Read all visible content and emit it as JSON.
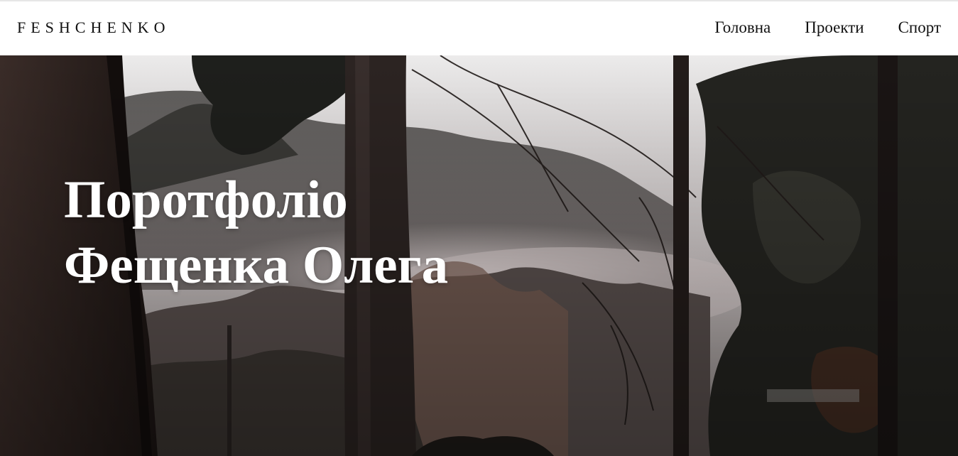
{
  "header": {
    "brand": "FESHCHENKO",
    "nav": [
      {
        "label": "Головна"
      },
      {
        "label": "Проекти"
      },
      {
        "label": "Спорт"
      }
    ]
  },
  "hero": {
    "title_line1": "Поротфоліо",
    "title_line2": "Фещенка Олега",
    "background": "misty-forest-photo",
    "colors": {
      "sky": "#e9e6e6",
      "fog": "#c9bfbf",
      "foliage": "#2e2f2b",
      "trunk": "#2a2220"
    }
  }
}
